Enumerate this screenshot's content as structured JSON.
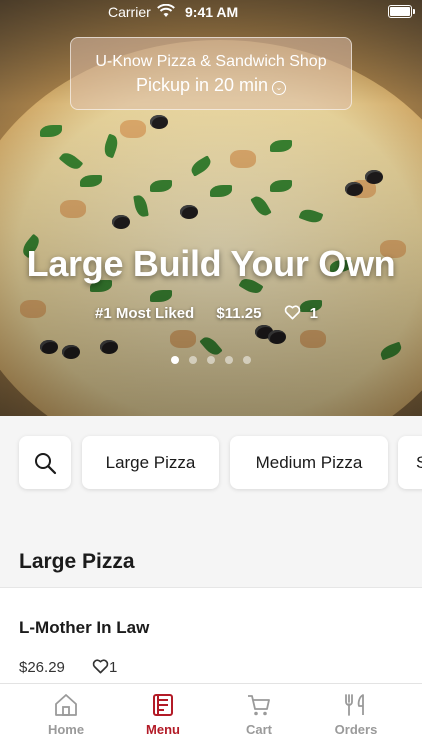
{
  "status_bar": {
    "carrier": "Carrier",
    "time": "9:41 AM"
  },
  "shop": {
    "name": "U-Know Pizza & Sandwich Shop",
    "pickup": "Pickup in 20 min"
  },
  "hero": {
    "title": "Large Build Your Own",
    "tag": "#1 Most Liked",
    "price": "$11.25",
    "likes": "1",
    "carousel_pages": 5,
    "active_page": 1
  },
  "categories": [
    "Large Pizza",
    "Medium Pizza",
    "S"
  ],
  "section": {
    "title": "Large Pizza"
  },
  "items": [
    {
      "name": "L-Mother In Law",
      "price": "$26.29",
      "likes": "1"
    }
  ],
  "tabs": [
    {
      "label": "Home",
      "icon": "home-icon"
    },
    {
      "label": "Menu",
      "icon": "menu-icon",
      "active": true
    },
    {
      "label": "Cart",
      "icon": "cart-icon"
    },
    {
      "label": "Orders",
      "icon": "orders-icon"
    }
  ],
  "colors": {
    "accent": "#b31b27",
    "inactive_tab": "#9a9a9a"
  }
}
